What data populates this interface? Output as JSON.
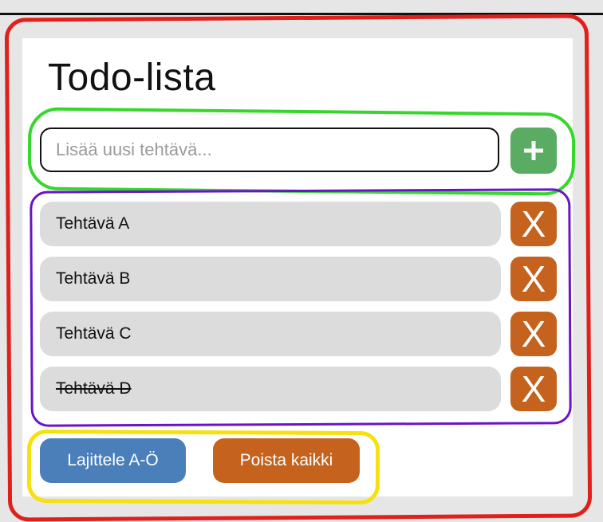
{
  "app": {
    "title": "Todo-lista"
  },
  "new_task": {
    "placeholder": "Lisää uusi tehtävä...",
    "value": "",
    "add_label": "+"
  },
  "todos": [
    {
      "label": "Tehtävä A",
      "done": false
    },
    {
      "label": "Tehtävä B",
      "done": false
    },
    {
      "label": "Tehtävä C",
      "done": false
    },
    {
      "label": "Tehtävä D",
      "done": true
    }
  ],
  "delete_label": "X",
  "actions": {
    "sort_label": "Lajittele A-Ö",
    "clear_label": "Poista kaikki"
  },
  "colors": {
    "add_button": "#5aac62",
    "delete_button": "#c4621e",
    "sort_button": "#4a7fba",
    "clear_button": "#c4621e",
    "annotation_outer": "#e0201c",
    "annotation_input": "#35d82a",
    "annotation_list": "#6a14c8",
    "annotation_actions": "#f6e10e"
  },
  "icons": {
    "add": "plus-icon",
    "delete": "close-icon"
  }
}
